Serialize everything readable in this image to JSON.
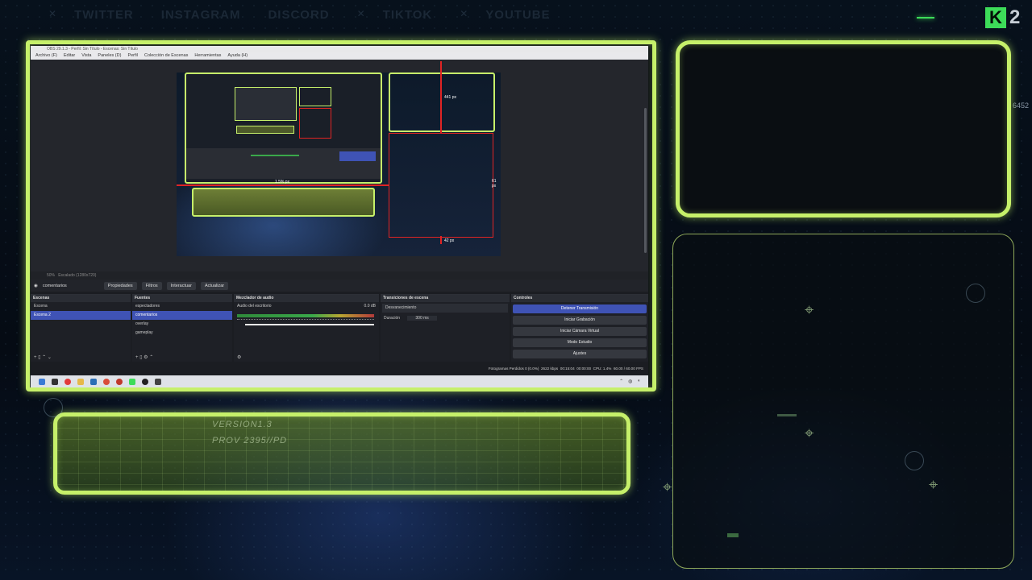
{
  "social": [
    {
      "name": "TWITTER"
    },
    {
      "name": "INSTAGRAM"
    },
    {
      "name": "DISCORD"
    },
    {
      "name": "TIKTOK"
    },
    {
      "name": "YOUTUBE"
    }
  ],
  "logo": {
    "letter": "K",
    "number": "2"
  },
  "side_number": "6452",
  "lower_bar": {
    "line1": "VERSION1.3",
    "line2": "PROV 2395//PD"
  },
  "obs": {
    "title": "OBS 29.1.3 - Perfil: Sin Título - Escenas: Sin Título",
    "menu": [
      "Archivo (F)",
      "Editar",
      "Vista",
      "Paneles (D)",
      "Perfil",
      "Colección de Escenas",
      "Herramientas",
      "Ayuda (H)"
    ],
    "preview_labels": {
      "top": "441 px",
      "right": "61 px",
      "bottom": "42 px",
      "mid": "1.5% px"
    },
    "status_left": "50%",
    "status_scale": "Escalado (1280x720)",
    "toolbar": {
      "source": "comentarios",
      "properties": "Propiedades",
      "filters": "Filtros",
      "interact": "Interactuar",
      "refresh": "Actualizar"
    },
    "scenes": {
      "title": "Escenas",
      "items": [
        "Escena",
        "Escena 2"
      ],
      "selected": 1
    },
    "sources": {
      "title": "Fuentes",
      "items": [
        "espectadores",
        "comentarios",
        "overlay",
        "gameplay"
      ],
      "selected": 1
    },
    "mixer": {
      "title": "Mezclador de audio",
      "channel": "Audio del escritorio",
      "level": "0.0 dB"
    },
    "transitions": {
      "title": "Transiciones de escena",
      "type": "Desvanecimiento",
      "duration_label": "Duración",
      "duration": "300 ms"
    },
    "controls": {
      "title": "Controles",
      "buttons": [
        "Detener Transmisión",
        "Iniciar Grabación",
        "Iniciar Cámara Virtual",
        "Modo Estudio",
        "Ajustes"
      ]
    },
    "status": {
      "dropped": "Fotogramas Perdidos 0 (0.0%)",
      "bitrate": "2622 kbps",
      "stream_time": "00:15:04",
      "rec_time": "00:00:00",
      "cpu": "CPU: 1.4%",
      "fps": "60.00 / 60.00 FPS"
    }
  },
  "colors": {
    "accent": "#c6f06a",
    "green": "#3ddc59",
    "selection": "#3f53b5",
    "red": "#e02424"
  }
}
